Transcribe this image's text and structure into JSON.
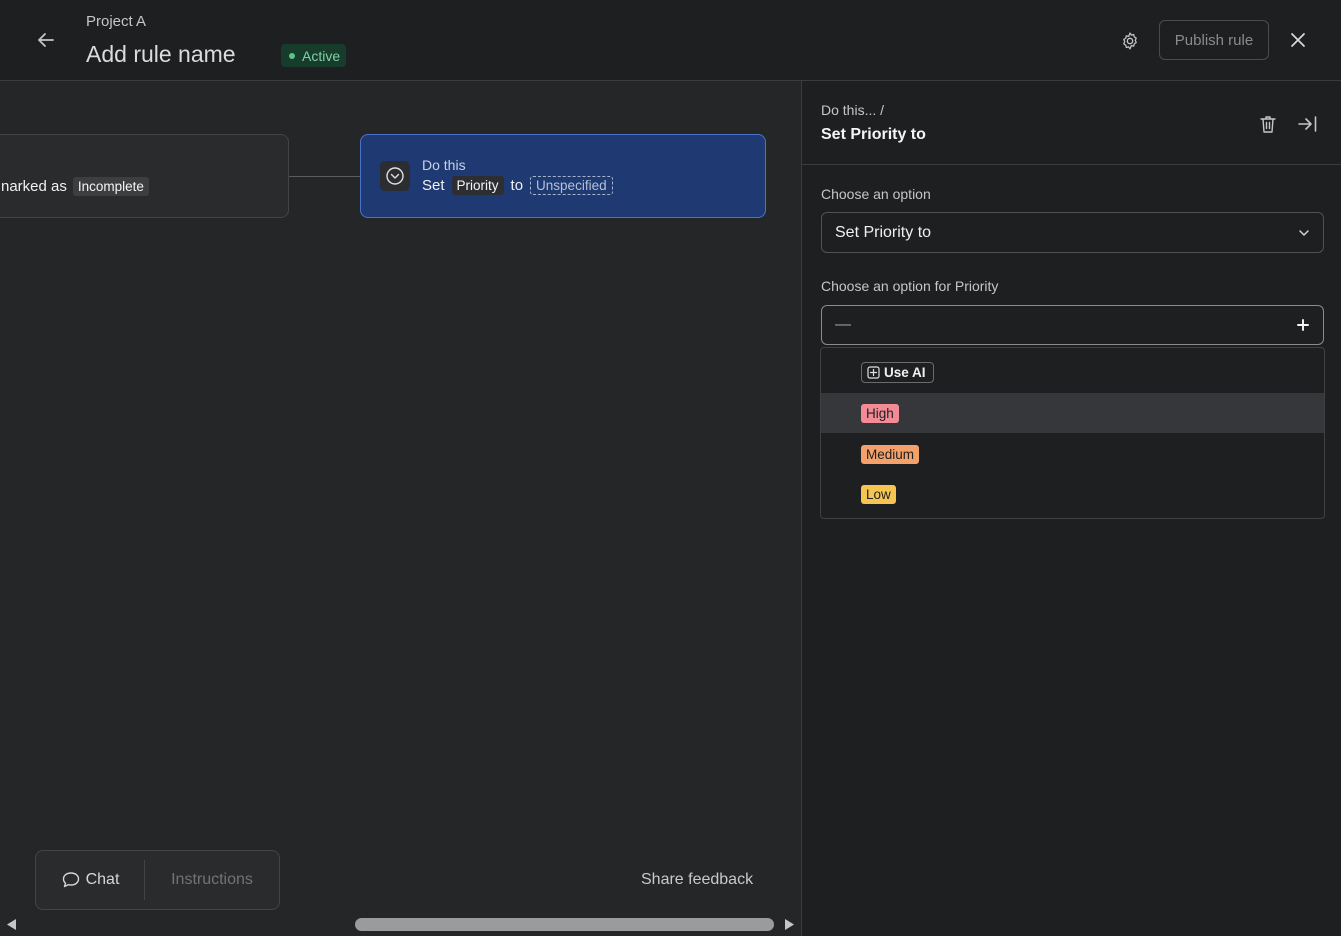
{
  "header": {
    "project": "Project A",
    "rule_name": "Add rule name",
    "status": "Active",
    "publish_label": "Publish rule"
  },
  "canvas": {
    "trigger": {
      "text_prefix": "narked as",
      "value": "Incomplete"
    },
    "action": {
      "label": "Do this",
      "verb": "Set",
      "field": "Priority",
      "connector": "to",
      "value": "Unspecified"
    },
    "bottom": {
      "chat_label": "Chat",
      "instructions_label": "Instructions",
      "feedback_label": "Share feedback"
    }
  },
  "panel": {
    "breadcrumb": "Do this...  /",
    "title": "Set Priority to",
    "option_label": "Choose an option",
    "option_value": "Set Priority to",
    "priority_label": "Choose an option for Priority",
    "priority_value": "—",
    "dropdown": {
      "ai_label": "Use AI",
      "options": [
        {
          "label": "High",
          "color": "#f28b95"
        },
        {
          "label": "Medium",
          "color": "#f3a06a"
        },
        {
          "label": "Low",
          "color": "#f5c451"
        }
      ]
    }
  },
  "colors": {
    "accent_blue": "#1f3a72",
    "active_green": "#7fd1a6"
  }
}
